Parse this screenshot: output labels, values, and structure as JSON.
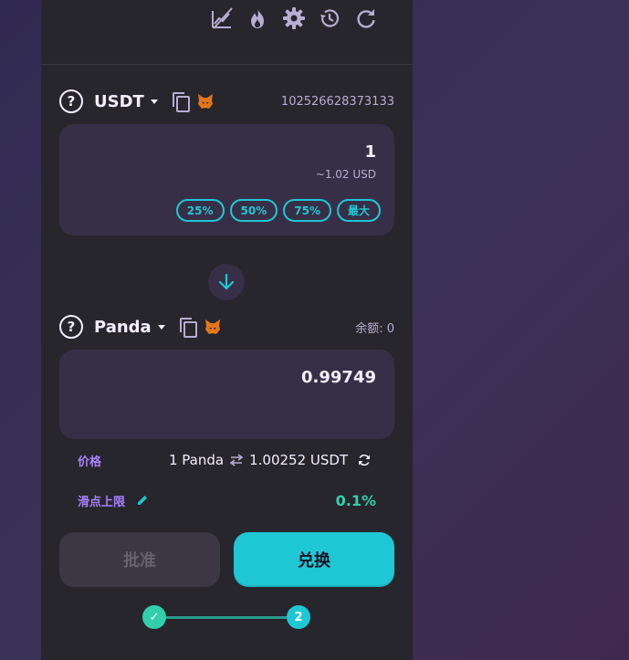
{
  "toolbar": {
    "icons": [
      "chart-disabled-icon",
      "fire-icon",
      "gear-icon",
      "history-icon",
      "refresh-icon"
    ]
  },
  "from": {
    "symbol": "USDT",
    "balance": "102526628373133",
    "amount": "1",
    "usd_value": "~1.02 USD",
    "percent_buttons": [
      "25%",
      "50%",
      "75%",
      "最大"
    ]
  },
  "to": {
    "symbol": "Panda",
    "balance_label": "余额: 0",
    "amount": "0.99749"
  },
  "price": {
    "label": "价格",
    "value_left": "1 Panda",
    "value_right": "1.00252 USDT"
  },
  "slippage": {
    "label": "滑点上限",
    "value": "0.1%"
  },
  "buttons": {
    "approve": "批准",
    "swap": "兑换"
  },
  "steps": {
    "step1": "✓",
    "step2": "2"
  },
  "colors": {
    "accent": "#1fc7d4",
    "secondary": "#a881fc",
    "success": "#31d0aa",
    "panel": "#27262c",
    "card": "#372f47"
  }
}
